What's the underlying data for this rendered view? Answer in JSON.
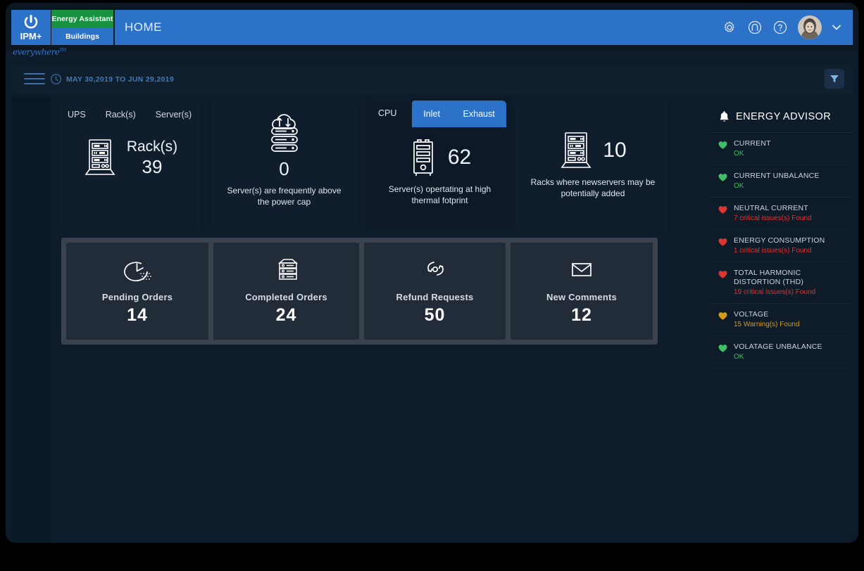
{
  "brand": {
    "logo_text": "IPM+",
    "logo_icon": "power-icon",
    "tagline": "everywhere",
    "tagline_tm": "TM",
    "product_label": "Energy Assistant",
    "section_label": "Buildings",
    "accent_blue": "#2d72c9",
    "accent_green": "#17923e"
  },
  "header": {
    "title": "HOME",
    "icons": [
      {
        "name": "gear-icon",
        "label": "Settings"
      },
      {
        "name": "user-circle-icon",
        "label": "Account"
      },
      {
        "name": "help-icon",
        "label": "Help"
      }
    ],
    "avatar": "user-avatar",
    "dropdown": "chevron-down-icon"
  },
  "toolbar": {
    "menu_icon": "hamburger-icon",
    "clock_icon": "clock-icon",
    "date_range": "MAY 30,2019 TO JUN 29,2019",
    "filter_icon": "filter-icon"
  },
  "cards_row1": [
    {
      "id": "rack-summary",
      "tabs": [
        {
          "label": "UPS",
          "active": false
        },
        {
          "label": "Rack(s)",
          "active": true
        },
        {
          "label": "Server(s)",
          "active": false
        }
      ],
      "icon": "server-rack-icon",
      "metric_name": "Rack(s)",
      "metric_value": "39"
    },
    {
      "id": "power-cap",
      "icon": "cloud-server-updown-icon",
      "value": "0",
      "caption": "Server(s) are frequently above the power cap"
    },
    {
      "id": "thermal-footprint",
      "tabs": [
        {
          "label": "CPU",
          "active": false
        },
        {
          "label": "Inlet",
          "active": true
        },
        {
          "label": "Exhaust",
          "active": true
        }
      ],
      "icon": "server-tower-icon",
      "value": "62",
      "caption": "Server(s) opertating at high thermal fotprint"
    },
    {
      "id": "rack-capacity",
      "icon": "server-rack-icon",
      "value": "10",
      "caption": "Racks where newservers may be potentially added"
    }
  ],
  "cards_row2": [
    {
      "id": "pending-orders",
      "icon": "clock-dots-icon",
      "label": "Pending Orders",
      "value": "14"
    },
    {
      "id": "completed-orders",
      "icon": "server-stack-icon",
      "label": "Completed Orders",
      "value": "24"
    },
    {
      "id": "refund-requests",
      "icon": "refund-loop-icon",
      "label": "Refund Requests",
      "value": "50"
    },
    {
      "id": "new-comments",
      "icon": "envelope-icon",
      "label": "New Comments",
      "value": "12"
    }
  ],
  "advisor": {
    "icon": "bell-icon",
    "title": "ENERGY ADVISOR",
    "items": [
      {
        "name": "CURRENT",
        "status": "OK",
        "level": "ok"
      },
      {
        "name": "CURRENT UNBALANCE",
        "status": "OK",
        "level": "ok"
      },
      {
        "name": "NEUTRAL CURRENT",
        "status": "7 critical issues(s) Found",
        "level": "critical"
      },
      {
        "name": "ENERGY CONSUMPTION",
        "status": "1 critical issues(s) Found",
        "level": "critical"
      },
      {
        "name": "TOTAL HARMONIC DISTORTION (THD)",
        "status": "19 critical issues(s) Found",
        "level": "critical"
      },
      {
        "name": "VOLTAGE",
        "status": "15 Warning(s) Found",
        "level": "warning"
      },
      {
        "name": "VOLATAGE UNBALANCE",
        "status": "OK",
        "level": "ok"
      }
    ],
    "colors": {
      "ok": "#3fbf63",
      "critical": "#e0342f",
      "warning": "#d99a1a"
    }
  }
}
